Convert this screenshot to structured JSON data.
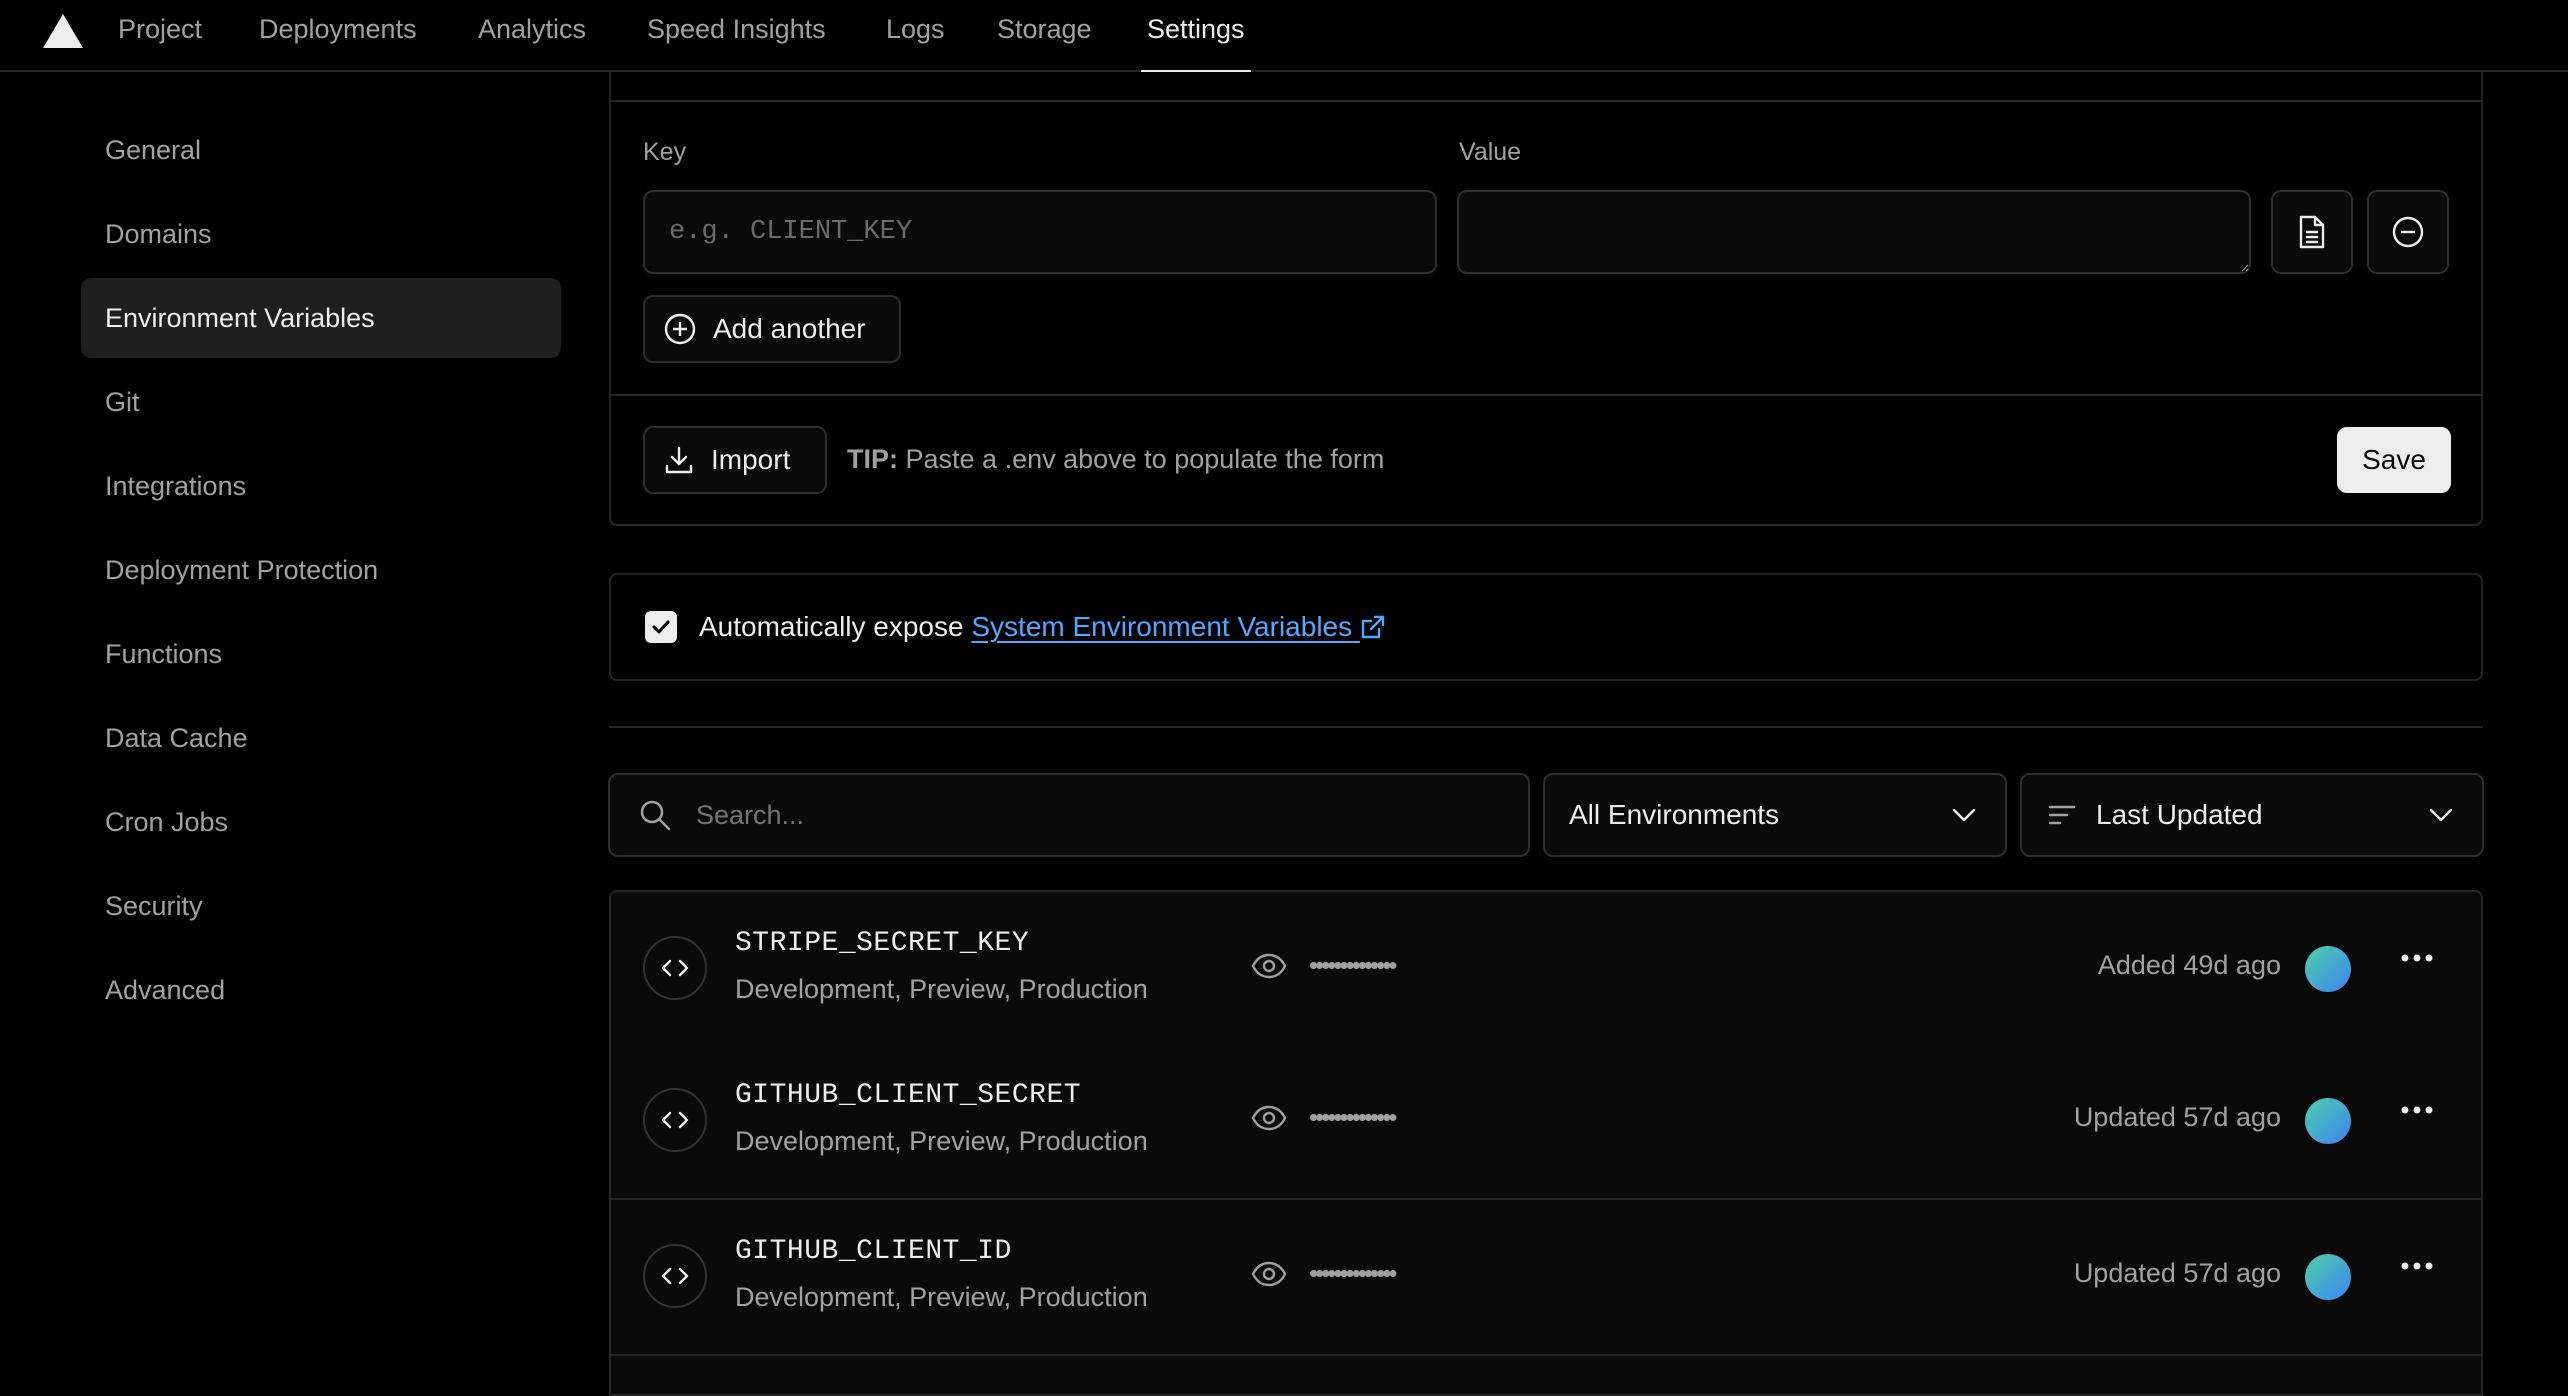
{
  "nav": {
    "tabs": [
      {
        "label": "Project"
      },
      {
        "label": "Deployments"
      },
      {
        "label": "Analytics"
      },
      {
        "label": "Speed Insights"
      },
      {
        "label": "Logs"
      },
      {
        "label": "Storage"
      },
      {
        "label": "Settings"
      }
    ],
    "active_tab": "Settings"
  },
  "sidebar": {
    "items": [
      {
        "label": "General"
      },
      {
        "label": "Domains"
      },
      {
        "label": "Environment Variables"
      },
      {
        "label": "Git"
      },
      {
        "label": "Integrations"
      },
      {
        "label": "Deployment Protection"
      },
      {
        "label": "Functions"
      },
      {
        "label": "Data Cache"
      },
      {
        "label": "Cron Jobs"
      },
      {
        "label": "Security"
      },
      {
        "label": "Advanced"
      }
    ],
    "active_item": "Environment Variables"
  },
  "form": {
    "key_label": "Key",
    "value_label": "Value",
    "key_placeholder": "e.g. CLIENT_KEY",
    "value_text": "",
    "add_another_label": "Add another",
    "import_label": "Import",
    "tip_prefix": "TIP:",
    "tip_text": "Paste a .env above to populate the form",
    "save_label": "Save"
  },
  "expose": {
    "checked": true,
    "text": "Automatically expose",
    "link_text": "System Environment Variables"
  },
  "filters": {
    "search_placeholder": "Search...",
    "environment_select": "All Environments",
    "sort_select": "Last Updated"
  },
  "variables": [
    {
      "name": "STRIPE_SECRET_KEY",
      "targets": "Development, Preview, Production",
      "masked": "••••••••••••••",
      "time": "Added 49d ago"
    },
    {
      "name": "GITHUB_CLIENT_SECRET",
      "targets": "Development, Preview, Production",
      "masked": "••••••••••••••",
      "time": "Updated 57d ago"
    },
    {
      "name": "GITHUB_CLIENT_ID",
      "targets": "Development, Preview, Production",
      "masked": "••••••••••••••",
      "time": "Updated 57d ago"
    }
  ],
  "colors": {
    "background": "#000000",
    "link": "#52a8ff",
    "accent_white": "#ededed"
  }
}
